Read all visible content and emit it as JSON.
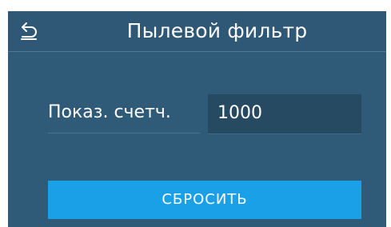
{
  "header": {
    "back_icon": "back-arrow-icon",
    "title": "Пылевой фильтр"
  },
  "counter": {
    "label": "Показ. счетч.",
    "value": "1000"
  },
  "actions": {
    "reset_label": "СБРОСИТЬ"
  },
  "colors": {
    "background": "#2f5a78",
    "value_box": "#274a63",
    "accent_button": "#1aa0e6",
    "text": "#ffffff"
  }
}
